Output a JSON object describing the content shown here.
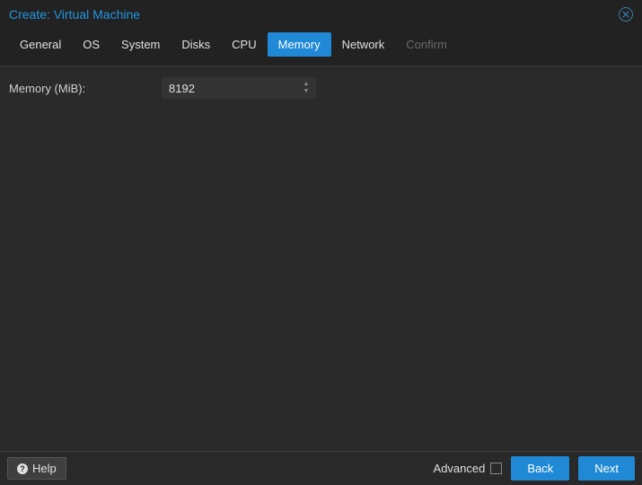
{
  "dialog": {
    "title": "Create: Virtual Machine"
  },
  "tabs": [
    {
      "label": "General",
      "state": "normal"
    },
    {
      "label": "OS",
      "state": "normal"
    },
    {
      "label": "System",
      "state": "normal"
    },
    {
      "label": "Disks",
      "state": "normal"
    },
    {
      "label": "CPU",
      "state": "normal"
    },
    {
      "label": "Memory",
      "state": "active"
    },
    {
      "label": "Network",
      "state": "normal"
    },
    {
      "label": "Confirm",
      "state": "disabled"
    }
  ],
  "form": {
    "memory": {
      "label": "Memory (MiB):",
      "value": "8192"
    }
  },
  "footer": {
    "help_label": "Help",
    "advanced_label": "Advanced",
    "advanced_checked": false,
    "back_label": "Back",
    "next_label": "Next"
  }
}
